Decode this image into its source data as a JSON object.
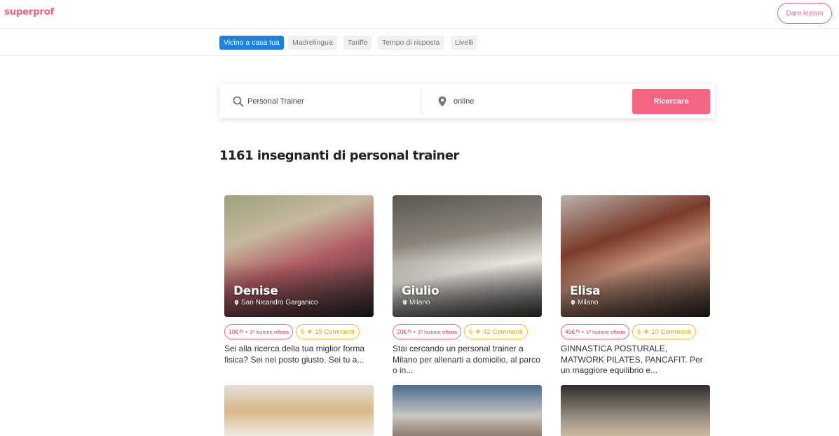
{
  "header": {
    "logo": "superprof",
    "give_lessons": "Dare lezioni"
  },
  "filters": [
    {
      "label": "Vicino a casa tua",
      "active": true
    },
    {
      "label": "Madrelingua",
      "active": false
    },
    {
      "label": "Tariffe",
      "active": false
    },
    {
      "label": "Tempo di risposta",
      "active": false
    },
    {
      "label": "Livelli",
      "active": false
    }
  ],
  "search": {
    "subject_value": "Personal Trainer",
    "location_value": "online",
    "button_label": "Ricercare"
  },
  "results": {
    "title": "1161 insegnanti di personal trainer"
  },
  "tutors": [
    {
      "name": "Denise",
      "location": "San Nicandro Garganico",
      "price": "10€",
      "per_hour": "/h",
      "offer": "1ª lezione offerta",
      "rating": "5",
      "reviews": "15 Commenti",
      "description": "Sei alla ricerca della tua miglior forma fisica? Sei nel posto giusto. Sei tu a..."
    },
    {
      "name": "Giulio",
      "location": "Milano",
      "price": "20€",
      "per_hour": "/h",
      "offer": "1ª lezione offerta",
      "rating": "5",
      "reviews": "42 Commenti",
      "description": "Stai cercando un personal trainer a Milano per allenarti a domicilio, al parco o in..."
    },
    {
      "name": "Elisa",
      "location": "Milano",
      "price": "45€",
      "per_hour": "/h",
      "offer": "1ª lezione offerta",
      "rating": "5",
      "reviews": "10 Commenti",
      "description": "GINNASTICA POSTURALE, MATWORK PILATES, PANCAFIT. Per un maggiore equilibrio e..."
    }
  ],
  "icons": {
    "search": "search-icon",
    "location": "map-pin-icon",
    "rating": "star-icon"
  },
  "colors": {
    "brand_pink": "#f06583",
    "active_filter_blue": "#1b82e0",
    "rating_gold": "#f3b22a"
  }
}
